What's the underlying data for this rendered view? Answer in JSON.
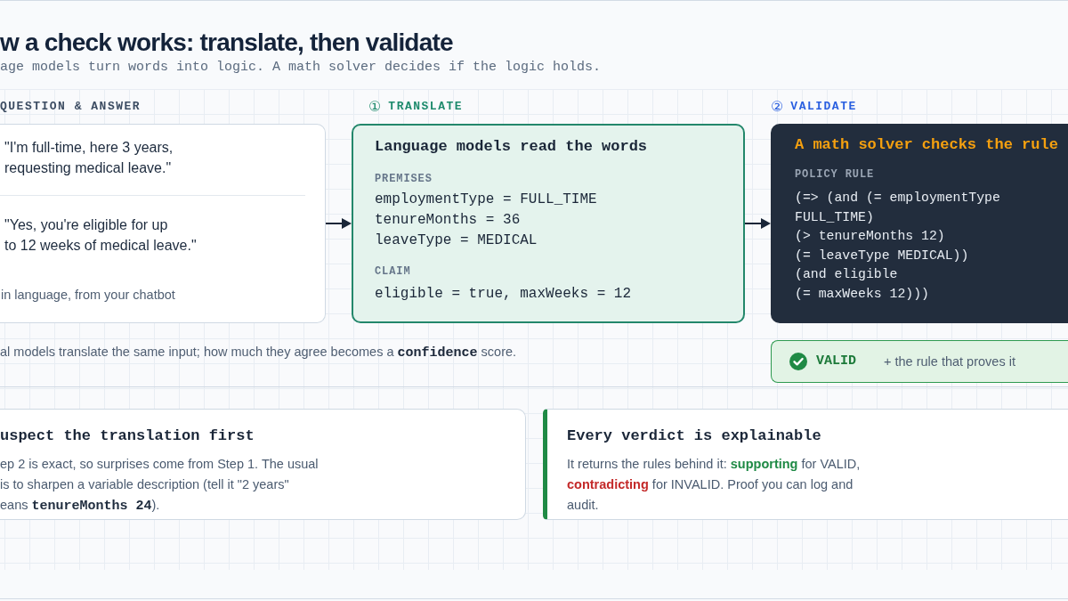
{
  "header": {
    "title": "w a check works: translate, then validate",
    "subtitle": "age models turn words into logic. A math solver decides if the logic holds."
  },
  "question_answer": {
    "label": "QUESTION & ANSWER",
    "question": "\"I'm full-time, here 3 years,\nrequesting medical leave.\"",
    "answer": "\"Yes, you're eligible for up\nto 12 weeks of medical leave.\"",
    "caption": "in language, from your chatbot"
  },
  "translate": {
    "step": "①",
    "label": "TRANSLATE",
    "heading": "Language models read the words",
    "premises_label": "PREMISES",
    "premises": [
      "employmentType = FULL_TIME",
      "tenureMonths = 36",
      "leaveType = MEDICAL"
    ],
    "claim_label": "CLAIM",
    "claim": "eligible = true, maxWeeks = 12"
  },
  "validate": {
    "step": "②",
    "label": "VALIDATE",
    "heading": "A math solver checks the rule",
    "rule_label": "POLICY RULE",
    "rule": "(=> (and (= employmentType\nFULL_TIME)\n(> tenureMonths 12)\n(= leaveType MEDICAL))\n(and eligible\n(= maxWeeks 12)))"
  },
  "footnote": "al models translate the same input; how much they agree becomes a **confidence** score.",
  "verdict": {
    "label": "VALID",
    "note": "+ the rule that proves it"
  },
  "notes": [
    {
      "kind": "plain",
      "heading": "uspect the translation first",
      "body": [
        {
          "kind": "text",
          "text": "ep 2 is exact, so surprises come from Step 1. The usual\nis to sharpen a variable description (tell it \"2 years\"\neans "
        },
        {
          "kind": "code",
          "text": "tenureMonths 24"
        },
        {
          "kind": "text",
          "text": ")."
        }
      ]
    },
    {
      "kind": "accent",
      "heading": "Every verdict is explainable",
      "body": [
        {
          "kind": "text",
          "text": "It returns the rules behind it: "
        },
        {
          "kind": "strong",
          "text": "supporting",
          "color": "#1f8a45"
        },
        {
          "kind": "text",
          "text": " for VALID,\n"
        },
        {
          "kind": "strong",
          "text": "contradicting",
          "color": "#c42b2b"
        },
        {
          "kind": "text",
          "text": " for INVALID. Proof you can log and\naudit."
        }
      ]
    }
  ]
}
